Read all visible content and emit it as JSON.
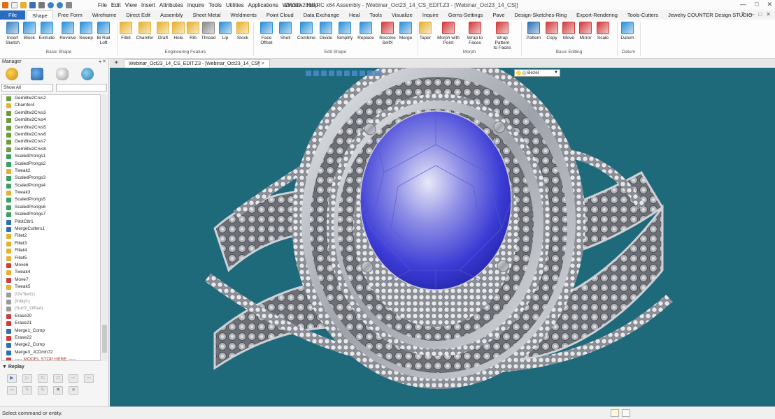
{
  "title": "ZW3D 2015 RC x64          Assembly - [Webinar_Oct23_14_CS_EDIT.Z3 - [Webinar_Oct23_14_CS]]",
  "menu": [
    "File",
    "Edit",
    "View",
    "Insert",
    "Attributes",
    "Inquire",
    "Tools",
    "Utilities",
    "Applications",
    "Window",
    "Help"
  ],
  "ribbon_tabs": [
    "File",
    "Shape",
    "Free Form",
    "Wireframe",
    "Direct Edit",
    "Assembly",
    "Sheet Metal",
    "Weldments",
    "Point Cloud",
    "Data Exchange",
    "Heal",
    "Tools",
    "Visualize",
    "Inquire",
    "Gems-Settings",
    "Pave",
    "Design-Sketches-Ring",
    "Export-Rendering",
    "Tools-Cutters",
    "Jewelry COUNTER Design STUDIO"
  ],
  "active_tab": "Shape",
  "ribbon_buttons": [
    {
      "label": "Insert\nSketch",
      "color": "#3b82c4"
    },
    {
      "label": "Block",
      "color": "#2b8fd6"
    },
    {
      "label": "Extrude",
      "color": "#2b8fd6"
    },
    {
      "label": "Revolve",
      "color": "#2b8fd6"
    },
    {
      "label": "Sweep",
      "color": "#2b8fd6"
    },
    {
      "label": "Bi Rail\nLoft",
      "color": "#2b8fd6"
    },
    {
      "label": "Fillet",
      "color": "#e6b12e"
    },
    {
      "label": "Chamfer",
      "color": "#e6b12e"
    },
    {
      "label": "Draft",
      "color": "#e6b12e"
    },
    {
      "label": "Hole",
      "color": "#e6b12e"
    },
    {
      "label": "Rib",
      "color": "#e6b12e"
    },
    {
      "label": "Thread",
      "color": "#8a8a8a"
    },
    {
      "label": "Lip",
      "color": "#2b8fd6"
    },
    {
      "label": "Stock",
      "color": "#e6b12e"
    },
    {
      "label": "Face\nOffset",
      "color": "#2b8fd6"
    },
    {
      "label": "Shell",
      "color": "#2b8fd6"
    },
    {
      "label": "Combine",
      "color": "#2b8fd6"
    },
    {
      "label": "Divide",
      "color": "#2b8fd6"
    },
    {
      "label": "Simplify",
      "color": "#2b8fd6"
    },
    {
      "label": "Replace",
      "color": "#2b8fd6"
    },
    {
      "label": "Resolve\nSelfX",
      "color": "#d23b3b"
    },
    {
      "label": "Merge",
      "color": "#2b8fd6"
    },
    {
      "label": "Taper",
      "color": "#e6b12e"
    },
    {
      "label": "Morph with\nPoint",
      "color": "#d23b3b"
    },
    {
      "label": "Wrap to\nFaces",
      "color": "#d23b3b"
    },
    {
      "label": "Wrap Pattern\nto Faces",
      "color": "#d23b3b"
    },
    {
      "label": "Pattern",
      "color": "#2b6fb6"
    },
    {
      "label": "Copy",
      "color": "#d23b3b"
    },
    {
      "label": "Move",
      "color": "#d23b3b"
    },
    {
      "label": "Mirror",
      "color": "#d23b3b"
    },
    {
      "label": "Scale",
      "color": "#d23b3b"
    },
    {
      "label": "Datum",
      "color": "#2b8fd6"
    }
  ],
  "ribbon_groups": [
    "Basic Shape",
    "Engineering Feature",
    "Edit Shape",
    "Morph",
    "Basic Editing",
    "Datum"
  ],
  "manager": {
    "title": "Manager",
    "filter": "Show All",
    "history": [
      {
        "label": "Gem8tw2Crvs2",
        "color": "#6b9e3a",
        "dim": false
      },
      {
        "label": "Chamfer4",
        "color": "#e6b12e",
        "dim": false
      },
      {
        "label": "Gem8tw2Crvs3",
        "color": "#6b9e3a",
        "dim": false
      },
      {
        "label": "Gem8tw2Crvs4",
        "color": "#6b9e3a",
        "dim": false
      },
      {
        "label": "Gem8tw2Crvs5",
        "color": "#6b9e3a",
        "dim": false
      },
      {
        "label": "Gem8tw2Crvs6",
        "color": "#6b9e3a",
        "dim": false
      },
      {
        "label": "Gem8tw2Crvs7",
        "color": "#6b9e3a",
        "dim": false
      },
      {
        "label": "Gem8tw2Crvs8",
        "color": "#6b9e3a",
        "dim": false
      },
      {
        "label": "ScaledProngs1",
        "color": "#3aa060",
        "dim": false
      },
      {
        "label": "ScaledProngs2",
        "color": "#3aa060",
        "dim": false
      },
      {
        "label": "Tweak2",
        "color": "#e6b12e",
        "dim": false
      },
      {
        "label": "ScaledProngs3",
        "color": "#3aa060",
        "dim": false
      },
      {
        "label": "ScaledProngs4",
        "color": "#3aa060",
        "dim": false
      },
      {
        "label": "Tweak3",
        "color": "#e6b12e",
        "dim": false
      },
      {
        "label": "ScaledProngs5",
        "color": "#3aa060",
        "dim": false
      },
      {
        "label": "ScaledProngs6",
        "color": "#3aa060",
        "dim": false
      },
      {
        "label": "ScaledProngs7",
        "color": "#3aa060",
        "dim": false
      },
      {
        "label": "PilotCttr1",
        "color": "#2b6fb6",
        "dim": false
      },
      {
        "label": "MergeCutters1",
        "color": "#2b6fb6",
        "dim": false
      },
      {
        "label": "Fillet2",
        "color": "#e6b12e",
        "dim": false
      },
      {
        "label": "Fillet3",
        "color": "#e6b12e",
        "dim": false
      },
      {
        "label": "Fillet4",
        "color": "#e6b12e",
        "dim": false
      },
      {
        "label": "Fillet5",
        "color": "#e6b12e",
        "dim": false
      },
      {
        "label": "Move6",
        "color": "#d23b3b",
        "dim": false
      },
      {
        "label": "Tweak4",
        "color": "#e6b12e",
        "dim": false
      },
      {
        "label": "Move7",
        "color": "#d23b3b",
        "dim": false
      },
      {
        "label": "Tweak5",
        "color": "#e6b12e",
        "dim": false
      },
      {
        "label": "(UVText1)",
        "color": "#9a9a9a",
        "dim": true
      },
      {
        "label": "(Inlay1)",
        "color": "#9a9a9a",
        "dim": true
      },
      {
        "label": "(Surf7_Offset)",
        "color": "#9a9a9a",
        "dim": true
      },
      {
        "label": "Erase20",
        "color": "#d23b3b",
        "dim": false
      },
      {
        "label": "Erase21",
        "color": "#d23b3b",
        "dim": false
      },
      {
        "label": "Merge1_Comp",
        "color": "#2b6fb6",
        "dim": false
      },
      {
        "label": "Erase22",
        "color": "#d23b3b",
        "dim": false
      },
      {
        "label": "Merge2_Comp",
        "color": "#2b6fb6",
        "dim": false
      },
      {
        "label": "Merge3_JCDmh72",
        "color": "#2b6fb6",
        "dim": false
      }
    ],
    "stop_marker": "----- MODEL STOP HERE -----",
    "replay_title": "Replay"
  },
  "doc_tab": "Webinar_Oct23_14_CS_EDIT.Z3 - [Webinar_Oct23_14_CS]",
  "filter_value": "Bezel",
  "status": "Select command or entity.",
  "colors": {
    "viewport_bg": "#1e6a7b",
    "file_tab": "#2a6cc0",
    "gem_blue": "#3b3bd6",
    "metal": "#b8bcc4"
  }
}
